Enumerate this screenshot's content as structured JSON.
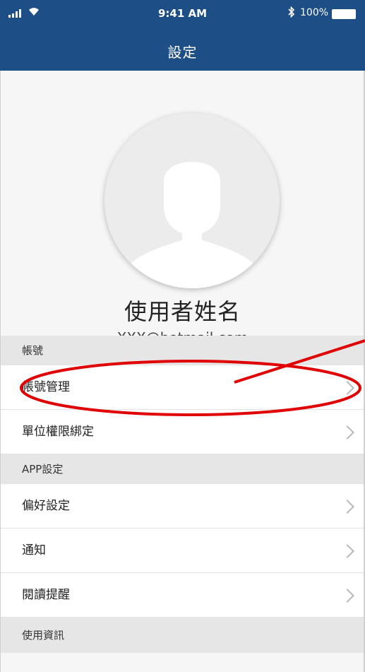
{
  "status": {
    "time": "9:41 AM",
    "battery": "100%",
    "signal_icon": "signal-bars-icon",
    "wifi_icon": "wifi-icon",
    "bluetooth_icon": "bluetooth-icon",
    "battery_icon": "battery-icon"
  },
  "nav": {
    "title": "設定"
  },
  "profile": {
    "name": "使用者姓名",
    "email": "XXX@hotmail.com",
    "avatar_icon": "user-silhouette-icon"
  },
  "sections": {
    "account": {
      "header": "帳號",
      "items": [
        "帳號管理",
        "單位權限綁定"
      ]
    },
    "app": {
      "header": "APP設定",
      "items": [
        "偏好設定",
        "通知",
        "閱讀提醒"
      ]
    },
    "usage": {
      "header": "使用資訊"
    }
  },
  "colors": {
    "nav_bar": "#1d4f86",
    "annotation": "#e00000",
    "section_header": "#e6e6e6"
  }
}
